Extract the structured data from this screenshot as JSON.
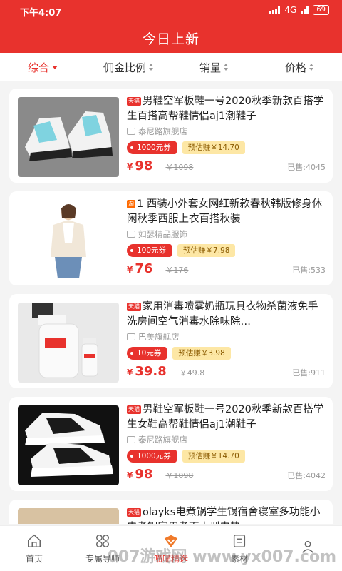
{
  "status": {
    "time": "下午4:07",
    "network": "4G",
    "battery": "69"
  },
  "header": {
    "title": "今日上新"
  },
  "sort": [
    {
      "label": "综合"
    },
    {
      "label": "佣金比例"
    },
    {
      "label": "销量"
    },
    {
      "label": "价格"
    }
  ],
  "products": [
    {
      "tag": "天猫",
      "title": "男鞋空军板鞋一号2020秋季新款百搭学生百搭高帮鞋情侣aj1潮鞋子",
      "shop": "泰尼路旗舰店",
      "coupon": "1000元券",
      "earn": "预估赚￥14.70",
      "price_symbol": "¥",
      "price": "98",
      "original": "￥1098",
      "sold": "已售:4045"
    },
    {
      "tag": "淘",
      "title": "1 西装小外套女网红新款春秋韩版修身休闲秋季西服上衣百搭秋装",
      "shop": "如瑟精品服饰",
      "coupon": "100元券",
      "earn": "预估赚￥7.98",
      "price_symbol": "¥",
      "price": "76",
      "original": "￥176",
      "sold": "已售:533"
    },
    {
      "tag": "天猫",
      "title": "家用消毒喷雾奶瓶玩具衣物杀菌液免手洗房间空气消毒水除味除…",
      "shop": "巴美旗舰店",
      "coupon": "10元券",
      "earn": "预估赚￥3.98",
      "price_symbol": "¥",
      "price": "39.8",
      "original": "￥49.8",
      "sold": "已售:911"
    },
    {
      "tag": "天猫",
      "title": "男鞋空军板鞋一号2020秋季新款百搭学生女鞋高帮鞋情侣aj1潮鞋子",
      "shop": "泰尼路旗舰店",
      "coupon": "1000元券",
      "earn": "预估赚￥14.70",
      "price_symbol": "¥",
      "price": "98",
      "original": "￥1098",
      "sold": "已售:4042"
    },
    {
      "tag": "天猫",
      "title": "olayks电煮锅学生锅宿舍寝室多功能小电煮锅家用煮面小型电热",
      "shop": "",
      "coupon": "",
      "earn": "",
      "price_symbol": "",
      "price": "",
      "original": "",
      "sold": ""
    }
  ],
  "tabs": [
    {
      "label": "首页",
      "icon": "home-icon"
    },
    {
      "label": "专属导师",
      "icon": "grid-icon"
    },
    {
      "label": "喵喵精选",
      "icon": "select-icon"
    },
    {
      "label": "素材",
      "icon": "material-icon"
    },
    {
      "label": "",
      "icon": "user-icon"
    }
  ],
  "watermark": "007游戏网 www.yx007.com",
  "colors": {
    "primary": "#e8322d",
    "earn_bg": "#fde7a5"
  }
}
